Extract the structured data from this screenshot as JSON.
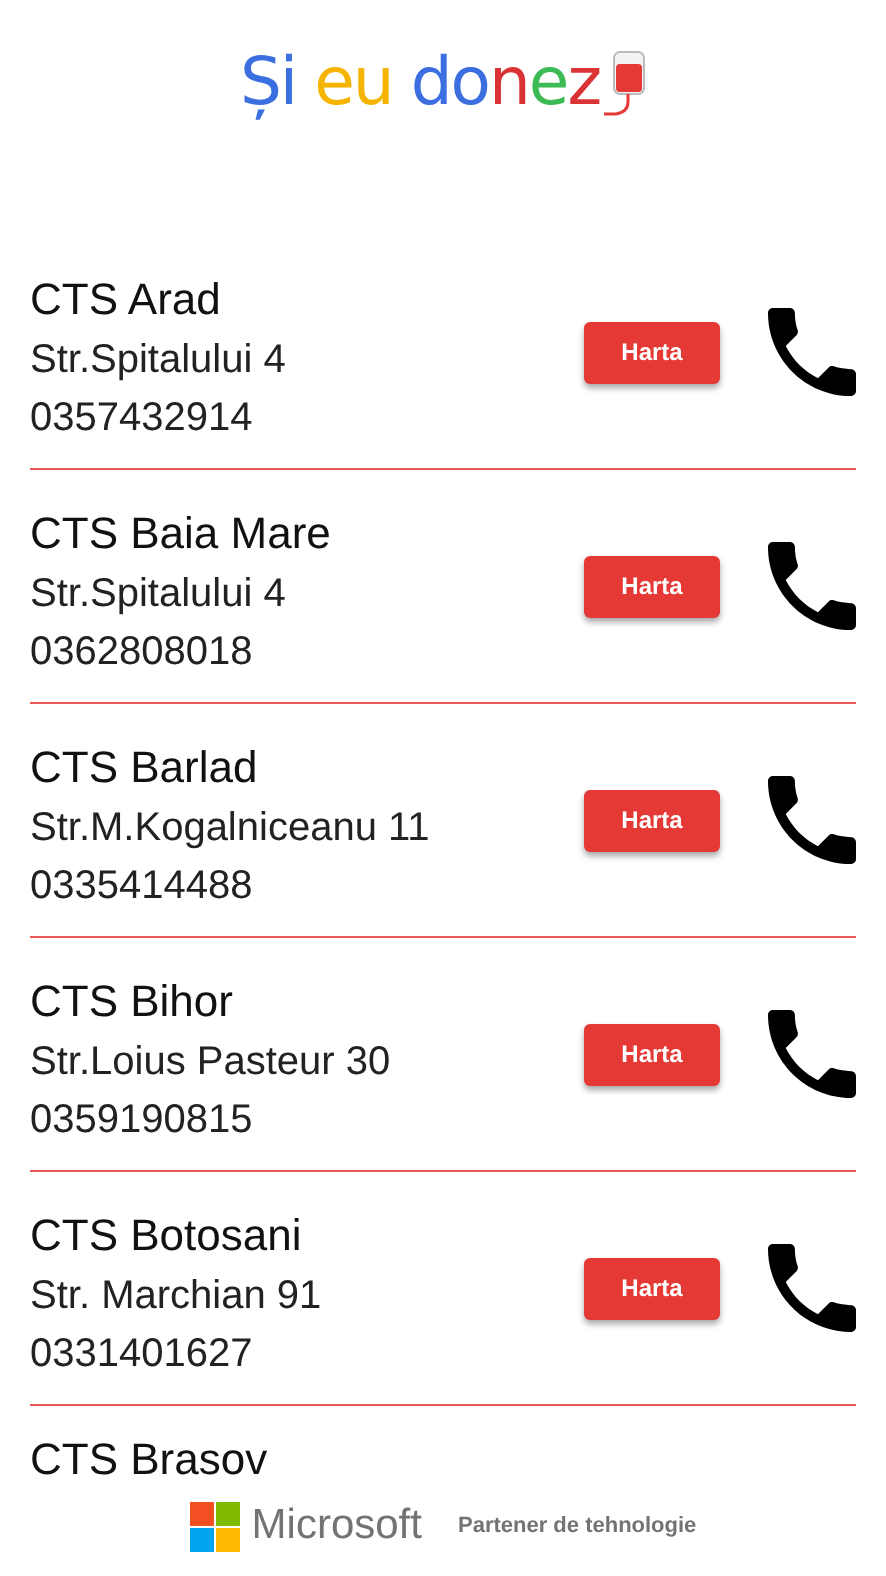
{
  "logo": {
    "words": [
      {
        "parts": [
          {
            "text": "Și",
            "color": "#3b6fe0"
          }
        ]
      },
      {
        "parts": [
          {
            "text": "eu",
            "color": "#f4b400"
          }
        ]
      },
      {
        "parts": [
          {
            "text": "do",
            "color": "#3b6fe0"
          },
          {
            "text": "n",
            "color": "#db3236"
          },
          {
            "text": "e",
            "color": "#3cba54"
          },
          {
            "text": "z",
            "color": "#db3236"
          }
        ]
      }
    ]
  },
  "centers": [
    {
      "name": "CTS Arad",
      "address": "Str.Spitalului 4",
      "phone": "0357432914",
      "button": "Harta"
    },
    {
      "name": "CTS Baia Mare",
      "address": "Str.Spitalului 4",
      "phone": "0362808018",
      "button": "Harta"
    },
    {
      "name": "CTS Barlad",
      "address": "Str.M.Kogalniceanu 11",
      "phone": "0335414488",
      "button": "Harta"
    },
    {
      "name": "CTS Bihor",
      "address": "Str.Loius Pasteur 30",
      "phone": "0359190815",
      "button": "Harta"
    },
    {
      "name": "CTS Botosani",
      "address": "Str. Marchian 91",
      "phone": "0331401627",
      "button": "Harta"
    },
    {
      "name": "CTS Brasov"
    }
  ],
  "footer": {
    "brand": "Microsoft",
    "tagline": "Partener de tehnologie"
  }
}
